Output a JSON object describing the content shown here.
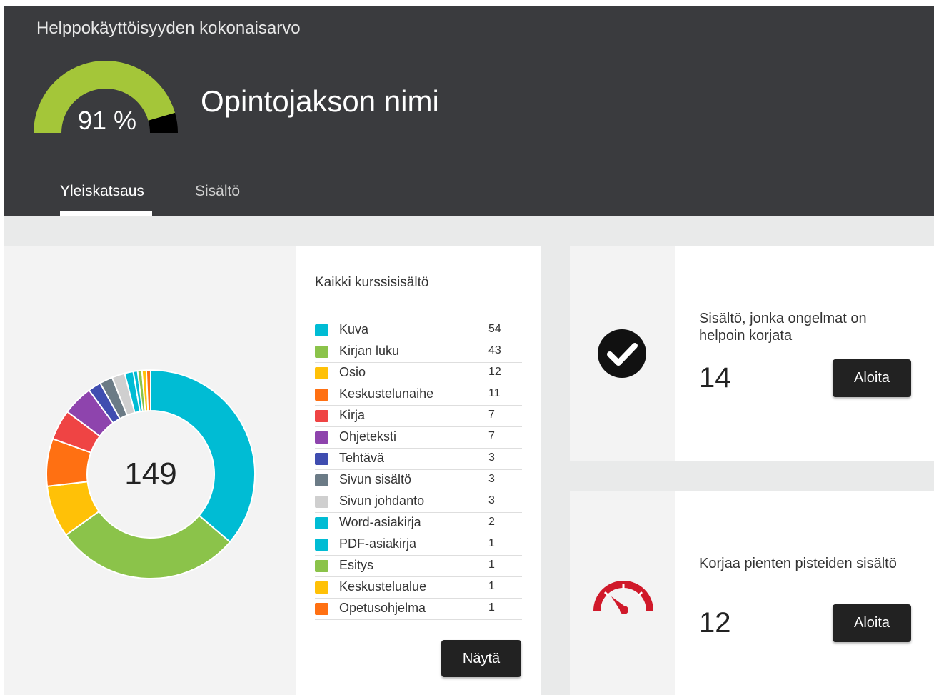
{
  "header": {
    "overall_label": "Helppokäyttöisyyden kokonaisarvo",
    "score_text": "91 %",
    "score_value": 91,
    "score_color": "#a4c639",
    "course_name": "Opintojakson nimi",
    "tabs": [
      {
        "label": "Yleiskatsaus",
        "active": true
      },
      {
        "label": "Sisältö",
        "active": false
      }
    ]
  },
  "content_summary": {
    "title": "Kaikki kurssisisältö",
    "total": "149",
    "show_button": "Näytä",
    "items": [
      {
        "label": "Kuva",
        "count": "54",
        "color": "#00bcd4"
      },
      {
        "label": "Kirjan luku",
        "count": "43",
        "color": "#8bc34a"
      },
      {
        "label": "Osio",
        "count": "12",
        "color": "#ffc107"
      },
      {
        "label": "Keskustelunaihe",
        "count": "11",
        "color": "#ff7012"
      },
      {
        "label": "Kirja",
        "count": "7",
        "color": "#ef4444"
      },
      {
        "label": "Ohjeteksti",
        "count": "7",
        "color": "#8e44ad"
      },
      {
        "label": "Tehtävä",
        "count": "3",
        "color": "#3f4db0"
      },
      {
        "label": "Sivun sisältö",
        "count": "3",
        "color": "#6b7b86"
      },
      {
        "label": "Sivun johdanto",
        "count": "3",
        "color": "#cfcfcf"
      },
      {
        "label": "Word-asiakirja",
        "count": "2",
        "color": "#00bcd4"
      },
      {
        "label": "PDF-asiakirja",
        "count": "1",
        "color": "#00bcd4"
      },
      {
        "label": "Esitys",
        "count": "1",
        "color": "#8bc34a"
      },
      {
        "label": "Keskustelualue",
        "count": "1",
        "color": "#ffc107"
      },
      {
        "label": "Opetusohjelma",
        "count": "1",
        "color": "#ff7012"
      }
    ]
  },
  "cards": [
    {
      "title": "Sisältö, jonka ongelmat on helpoin korjata",
      "count": "14",
      "button": "Aloita",
      "icon": "check-circle-icon"
    },
    {
      "title": "Korjaa pienten pisteiden sisältö",
      "count": "12",
      "button": "Aloita",
      "icon": "speedometer-icon"
    }
  ]
}
